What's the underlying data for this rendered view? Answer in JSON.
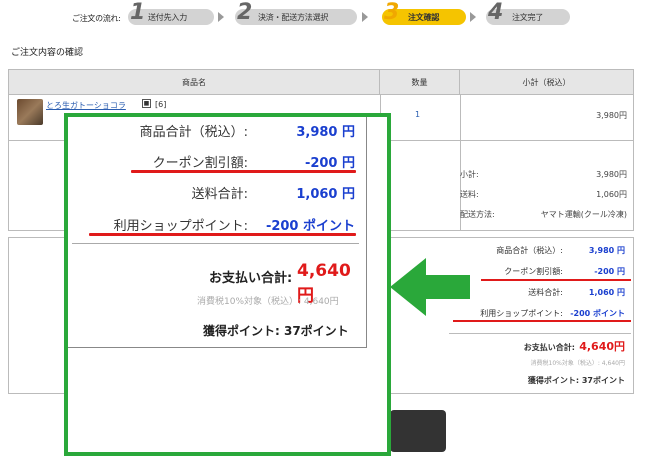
{
  "steps": {
    "label": "ご注文の流れ:",
    "items": [
      {
        "num": "1",
        "text": "送付先入力"
      },
      {
        "num": "2",
        "text": "決済・配送方法選択"
      },
      {
        "num": "3",
        "text": "注文確認"
      },
      {
        "num": "4",
        "text": "注文完了"
      }
    ]
  },
  "section_title": "ご注文内容の確認",
  "table": {
    "headers": [
      "商品名",
      "数量",
      "小計（税込）"
    ],
    "item": {
      "name": "とろ生ガトーショコラ",
      "badge": "■",
      "tag": "[6]",
      "qty": "1",
      "price": "3,980円"
    },
    "summary": [
      {
        "label": "小計:",
        "value": "3,980円"
      },
      {
        "label": "送料:",
        "value": "1,060円"
      },
      {
        "label": "配送方法:",
        "value": "ヤマト運輸(クール冷凍)"
      }
    ]
  },
  "totals": {
    "rows": [
      {
        "label": "商品合計（税込）:",
        "value": "3,980 円"
      },
      {
        "label": "クーポン割引額:",
        "value": "-200 円"
      },
      {
        "label": "送料合計:",
        "value": "1,060 円"
      },
      {
        "label": "利用ショップポイント:",
        "value": "-200 ポイント"
      }
    ],
    "pay_label": "お支払い合計:",
    "pay_value": "4,640円",
    "tax_note": "消費税10%対象（税込）: 4,640円",
    "earn": "獲得ポイント: 37ポイント"
  },
  "zoom": {
    "rows": [
      {
        "label": "商品合計（税込）:",
        "value": "3,980 円"
      },
      {
        "label": "クーポン割引額:",
        "value": "-200 円"
      },
      {
        "label": "送料合計:",
        "value": "1,060 円"
      },
      {
        "label": "利用ショップポイント:",
        "value": "-200 ポイント"
      }
    ],
    "pay_label": "お支払い合計:",
    "pay_value": "4,640円",
    "tax_note": "消費税10%対象（税込）: 4,640円",
    "earn": "獲得ポイント: 37ポイント"
  },
  "colors": {
    "highlight_green": "#2aa83a",
    "underline_red": "#e01a1a",
    "value_blue": "#1a3fcf",
    "step_active": "#f5c400"
  }
}
